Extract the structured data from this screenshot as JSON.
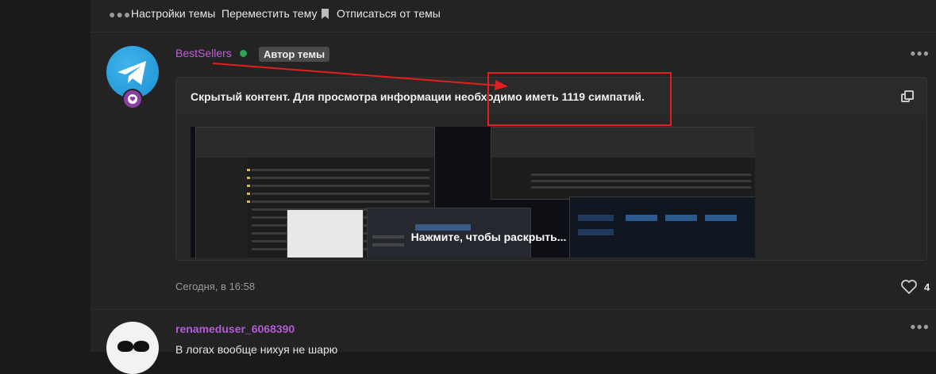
{
  "topbar": {
    "settings_label": "Настройки темы",
    "move_label": "Переместить тему",
    "unsubscribe_label": "Отписаться от темы"
  },
  "post1": {
    "author": "BestSellers",
    "role_badge": "Автор темы",
    "hidden_notice": "Скрытый контент. Для просмотра информации необходимо иметь 1119 симпатий.",
    "reveal_label": "Нажмите, чтобы раскрыть...",
    "timestamp": "Сегодня, в 16:58",
    "likes_count": "4"
  },
  "post2": {
    "author": "renameduser_6068390",
    "message": "В логах вообще нихуя не шарю"
  },
  "colors": {
    "background": "#1a1a1a",
    "panel": "#232323",
    "username": "#c060d9",
    "online": "#2ea44f",
    "annotation": "#e02020"
  },
  "icons": {
    "more": "more-dots-icon",
    "bookmark": "bookmark-icon",
    "copy": "copy-icon",
    "heart": "heart-icon",
    "online": "online-status-icon"
  }
}
